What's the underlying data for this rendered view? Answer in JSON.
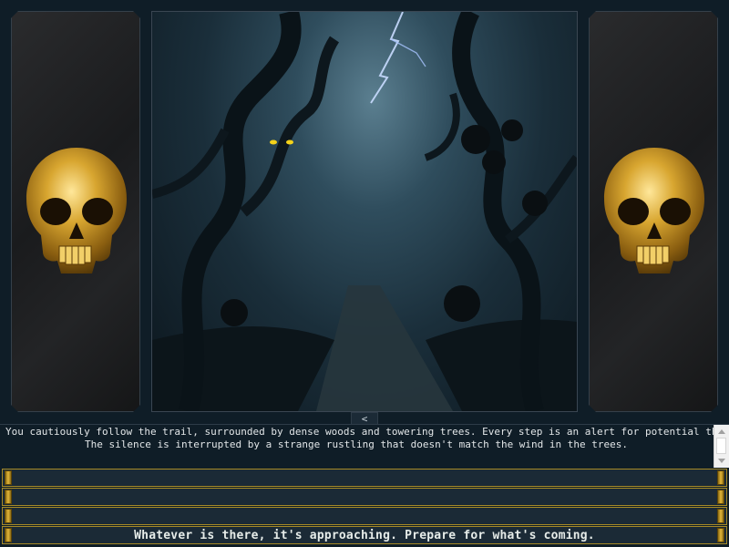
{
  "narrative": {
    "line1": "You cautiously follow the trail, surrounded by dense woods and towering trees. Every step is an alert for potential threats.",
    "line2": "The silence is interrupted by a strange rustling that doesn't match the wind in the trees."
  },
  "collapse_button": {
    "glyph": "<"
  },
  "choices": [
    {
      "label": ""
    },
    {
      "label": ""
    },
    {
      "label": ""
    },
    {
      "label": "Whatever is there, it's approaching. Prepare for what's coming."
    }
  ],
  "colors": {
    "background": "#0f1d27",
    "choice_bar": "#1b2a36",
    "gold_accent": "#d4a42a",
    "creature_eyes": "#f4d21a"
  },
  "icons": {
    "left_panel": "golden-skull-icon",
    "right_panel": "golden-skull-icon"
  }
}
